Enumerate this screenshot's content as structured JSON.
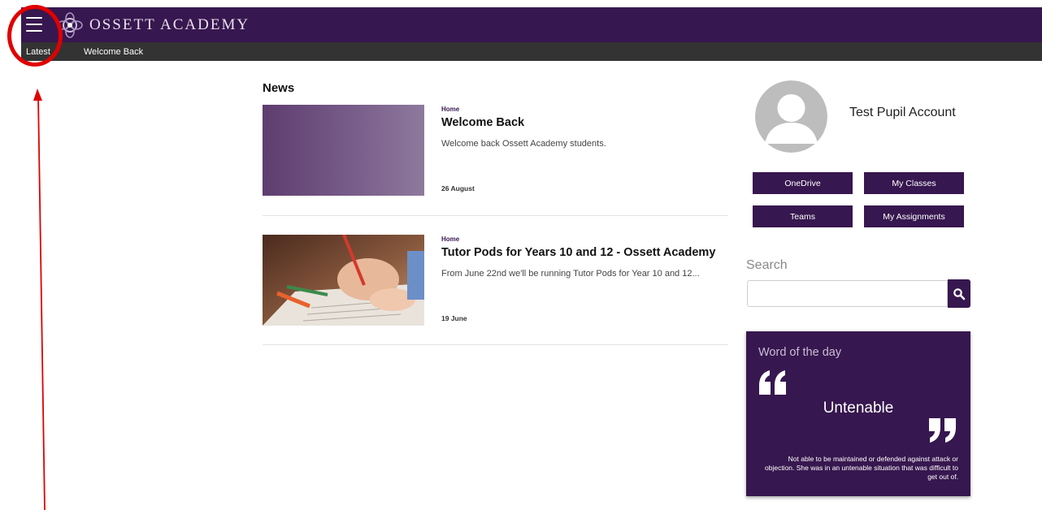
{
  "header": {
    "brand": "OSSETT ACADEMY",
    "menu_icon": "hamburger-menu-icon",
    "colors": {
      "primary": "#37174f",
      "subbar": "#333333",
      "annotation": "#e00000"
    }
  },
  "subnav": {
    "items": [
      "Latest",
      "Welcome Back"
    ]
  },
  "news": {
    "heading": "News",
    "articles": [
      {
        "category": "Home",
        "title": "Welcome Back",
        "summary": "Welcome back Ossett Academy students.",
        "date": "26 August",
        "image": "purple-gradient-image"
      },
      {
        "category": "Home",
        "title": "Tutor Pods for Years 10 and 12 - Ossett Academy",
        "summary": "From June 22nd we'll be running Tutor Pods for Year 10 and 12...",
        "date": "19 June",
        "image": "child-writing-photo"
      }
    ]
  },
  "profile": {
    "name": "Test Pupil Account",
    "avatar_icon": "default-avatar-icon"
  },
  "quick_links": [
    "OneDrive",
    "My Classes",
    "Teams",
    "My Assignments"
  ],
  "search": {
    "label": "Search",
    "placeholder": "",
    "icon": "search-icon"
  },
  "word_of_day": {
    "title": "Word of the day",
    "word": "Untenable",
    "definition": "Not able to be maintained or defended against attack or objection. She was in an untenable situation that was difficult to get out of."
  }
}
